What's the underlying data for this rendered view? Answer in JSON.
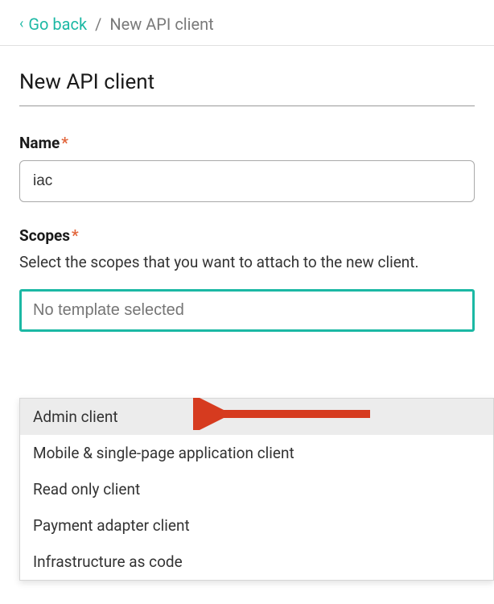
{
  "breadcrumb": {
    "back_label": "Go back",
    "current": "New API client"
  },
  "page": {
    "title": "New API client"
  },
  "fields": {
    "name": {
      "label": "Name",
      "value": "iac"
    },
    "scopes": {
      "label": "Scopes",
      "help": "Select the scopes that you want to attach to the new client.",
      "placeholder": "No template selected"
    }
  },
  "dropdown": {
    "options": [
      "Admin client",
      "Mobile & single-page application client",
      "Read only client",
      "Payment adapter client",
      "Infrastructure as code"
    ]
  }
}
